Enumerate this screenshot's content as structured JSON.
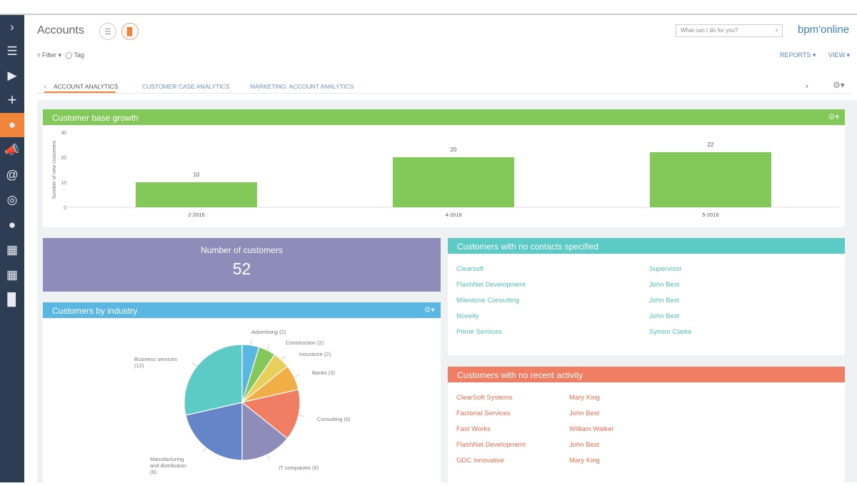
{
  "header": {
    "title": "Accounts",
    "filter": "Filter",
    "tag": "Tag",
    "search_placeholder": "What can I do for you?",
    "logo": "bpm'online",
    "reports": "REPORTS",
    "view": "VIEW"
  },
  "sidebar": {
    "items": [
      "chevron-right",
      "menu",
      "play",
      "plus",
      "accounts",
      "megaphone",
      "at",
      "target",
      "lightbulb",
      "buildings",
      "building",
      "chart"
    ],
    "active": "accounts"
  },
  "tabs": [
    "ACCOUNT ANALYTICS",
    "CUSTOMER CASE ANALYTICS",
    "MARKETING: ACCOUNT ANALYTICS"
  ],
  "colors": {
    "green": "#82c95a",
    "purple": "#8e8cb8",
    "blue": "#5ab7e2",
    "teal": "#5ccac5",
    "orange": "#f07e62",
    "accent": "#f0853a"
  },
  "growth": {
    "title": "Customer base growth",
    "chart_data": {
      "type": "bar",
      "ylabel": "Number of new customers",
      "ylim": [
        0,
        30
      ],
      "yticks": [
        "0",
        "10",
        "20",
        "30"
      ],
      "categories": [
        "2-2016",
        "4-2016",
        "5-2016"
      ],
      "values": [
        10,
        20,
        22
      ]
    }
  },
  "kpi": {
    "label": "Number of customers",
    "value": "52"
  },
  "industry": {
    "title": "Customers by industry",
    "chart_data": {
      "type": "pie",
      "slices": [
        {
          "label": "Advertising (2)",
          "value": 2,
          "color": "#5ab7e2"
        },
        {
          "label": "Construction (2)",
          "value": 2,
          "color": "#82c95a"
        },
        {
          "label": "Insurance (2)",
          "value": 2,
          "color": "#e8cf5a"
        },
        {
          "label": "Banks (3)",
          "value": 3,
          "color": "#f0ae45"
        },
        {
          "label": "Consulting (6)",
          "value": 6,
          "color": "#f07e62"
        },
        {
          "label": "IT companies (6)",
          "value": 6,
          "color": "#8e8cb8"
        },
        {
          "label": "Manufacturing and distribution (9)",
          "value": 9,
          "color": "#6585c8"
        },
        {
          "label": "Business services (12)",
          "value": 12,
          "color": "#5ccac5"
        }
      ]
    }
  },
  "no_contacts": {
    "title": "Customers with no contacts specified",
    "rows": [
      [
        "Clearsoft",
        "Supervisor"
      ],
      [
        "FlashNet Development",
        "John Best"
      ],
      [
        "Milestone Consulting",
        "John Best"
      ],
      [
        "Novelty",
        "John Best"
      ],
      [
        "Prime Services",
        "Symon Clarke"
      ]
    ]
  },
  "no_activity": {
    "title": "Customers with no recent activity",
    "rows": [
      [
        "ClearSoft Systems",
        "Mary King"
      ],
      [
        "Factorial Services",
        "John Best"
      ],
      [
        "Fast Works",
        "William Walker"
      ],
      [
        "FlashNet Development",
        "John Best"
      ],
      [
        "GDC Innovative",
        "Mary King"
      ]
    ]
  }
}
